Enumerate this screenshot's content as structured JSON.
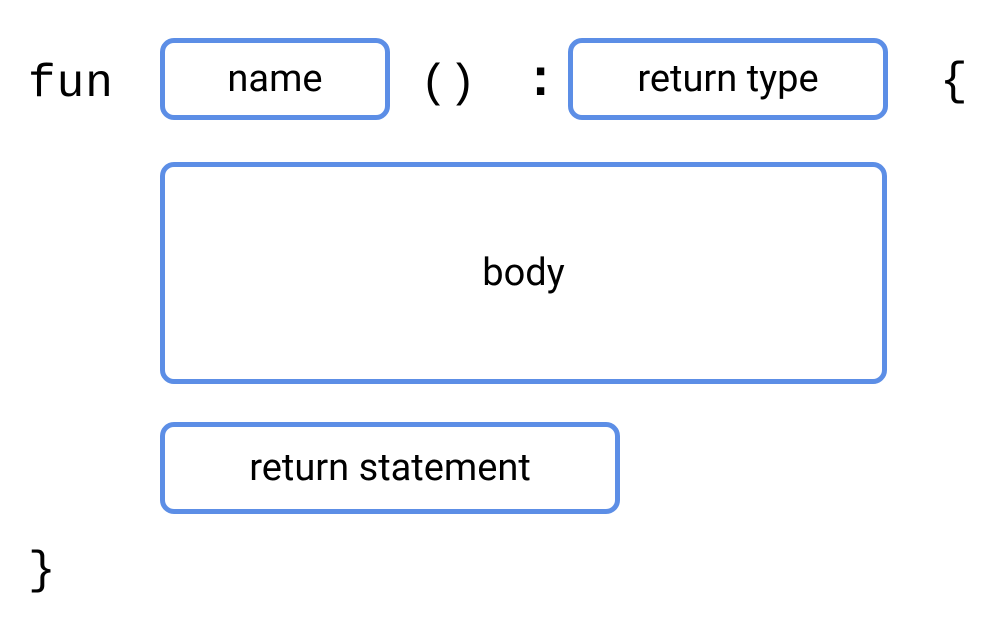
{
  "syntax": {
    "keyword": "fun",
    "name_placeholder": "name",
    "parens": "()",
    "colon": ":",
    "return_type_placeholder": "return type",
    "open_brace": "{",
    "body_placeholder": "body",
    "return_statement_placeholder": "return statement",
    "close_brace": "}"
  }
}
